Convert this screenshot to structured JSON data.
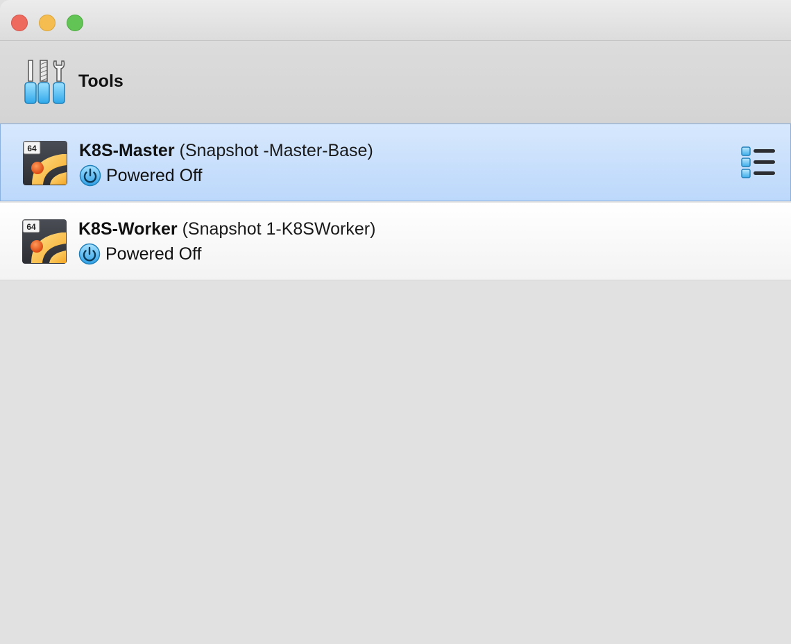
{
  "window": {
    "traffic_lights": {
      "close": "#ee6a5f",
      "minimize": "#f5bd4f",
      "zoom": "#61c454"
    }
  },
  "tools": {
    "label": "Tools",
    "icon": "tools-icon"
  },
  "vms": [
    {
      "name": "K8S-Master",
      "snapshot": "(Snapshot -Master-Base)",
      "state": "Powered Off",
      "badge": "64",
      "selected": true
    },
    {
      "name": "K8S-Worker",
      "snapshot": "(Snapshot 1-K8SWorker)",
      "state": "Powered Off",
      "badge": "64",
      "selected": false
    }
  ],
  "colors": {
    "selection": "#bcd8fb",
    "accent": "#3aa7e8"
  }
}
